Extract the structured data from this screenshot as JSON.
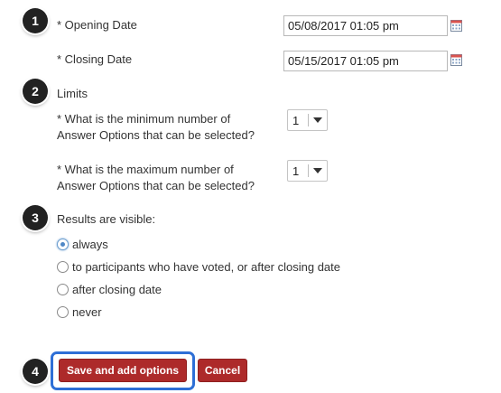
{
  "steps": [
    "1",
    "2",
    "3",
    "4"
  ],
  "opening": {
    "label": "* Opening Date",
    "value": "05/08/2017 01:05 pm"
  },
  "closing": {
    "label": "* Closing Date",
    "value": "05/15/2017 01:05 pm"
  },
  "limits": {
    "heading": "Limits",
    "min": {
      "label_line1": "* What is the minimum number of",
      "label_line2": "Answer Options that can be selected?",
      "value": "1"
    },
    "max": {
      "label_line1": "* What is the maximum number of",
      "label_line2": "Answer Options that can be selected?",
      "value": "1"
    }
  },
  "results": {
    "heading": "Results are visible:",
    "options": [
      {
        "label": "always",
        "selected": true
      },
      {
        "label": "to participants who have voted, or after closing date",
        "selected": false
      },
      {
        "label": "after closing date",
        "selected": false
      },
      {
        "label": "never",
        "selected": false
      }
    ]
  },
  "buttons": {
    "save": "Save and add options",
    "cancel": "Cancel"
  },
  "colors": {
    "accent_red": "#ad2a2a",
    "focus_blue": "#2e6fd6",
    "badge": "#222222"
  },
  "icons": {
    "calendar": "calendar-icon",
    "dropdown": "chevron-down-icon"
  }
}
